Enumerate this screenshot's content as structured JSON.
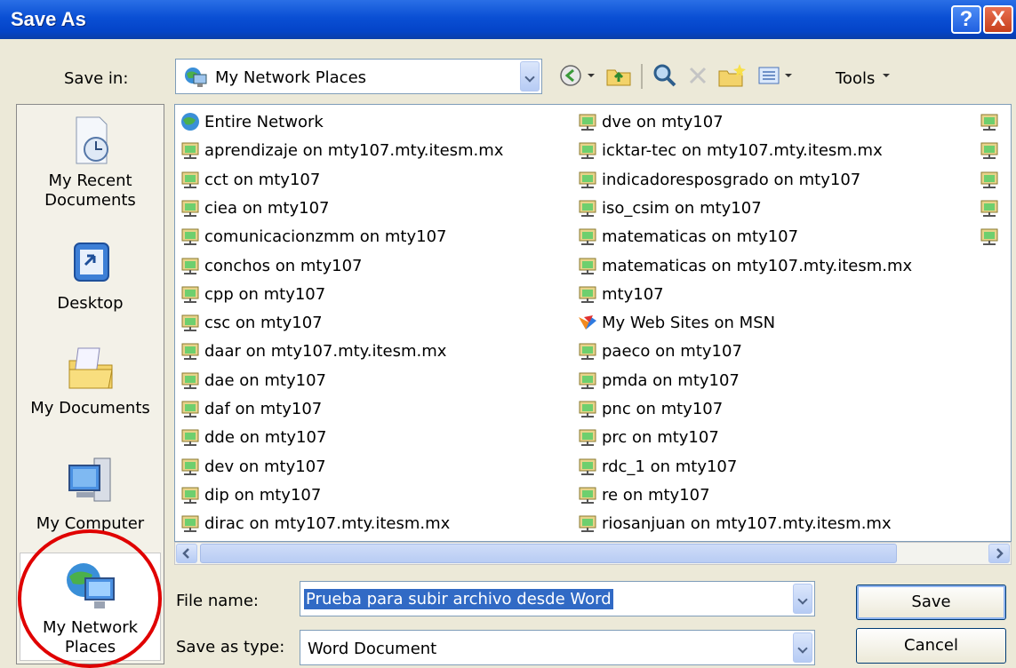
{
  "title": "Save As",
  "title_buttons": {
    "help": "?",
    "close": "X"
  },
  "save_in": {
    "label": "Save in:",
    "value": "My Network Places"
  },
  "toolbar": {
    "tools_label": "Tools",
    "icons": [
      "back-icon",
      "up-folder-icon",
      "search-web-icon",
      "delete-icon",
      "new-folder-icon",
      "views-icon"
    ]
  },
  "places": [
    {
      "label": "My Recent Documents",
      "icon": "recent-documents-icon"
    },
    {
      "label": "Desktop",
      "icon": "desktop-icon"
    },
    {
      "label": "My Documents",
      "icon": "my-documents-icon"
    },
    {
      "label": "My Computer",
      "icon": "my-computer-icon"
    },
    {
      "label": "My Network Places",
      "icon": "network-places-icon",
      "selected": true
    }
  ],
  "files_col1": [
    "Entire Network",
    "aprendizaje on mty107.mty.itesm.mx",
    "cct on mty107",
    "ciea on mty107",
    "comunicacionzmm on mty107",
    "conchos on mty107",
    "cpp on mty107",
    "csc on mty107",
    "daar on mty107.mty.itesm.mx",
    "dae on mty107",
    "daf on mty107",
    "dde on mty107",
    "dev on mty107",
    "dip on mty107",
    "dirac on mty107.mty.itesm.mx"
  ],
  "files_col2": [
    "dve on mty107",
    "icktar-tec on mty107.mty.itesm.mx",
    "indicadoresposgrado on mty107",
    "iso_csim on mty107",
    "matematicas on mty107",
    "matematicas on mty107.mty.itesm.mx",
    "mty107",
    "My Web Sites on MSN",
    "paeco on mty107",
    "pmda on mty107",
    "pnc on mty107",
    "prc on mty107",
    "rdc_1 on mty107",
    "re on mty107",
    "riosanjuan on mty107.mty.itesm.mx"
  ],
  "file_name": {
    "label": "File name:",
    "value": "Prueba para subir archivo desde Word"
  },
  "save_as_type": {
    "label": "Save as type:",
    "value": "Word Document"
  },
  "buttons": {
    "save": "Save",
    "cancel": "Cancel"
  },
  "colors": {
    "titlebar": "#0a4fd4",
    "selection": "#316ac5",
    "annotation": "#e00000"
  }
}
